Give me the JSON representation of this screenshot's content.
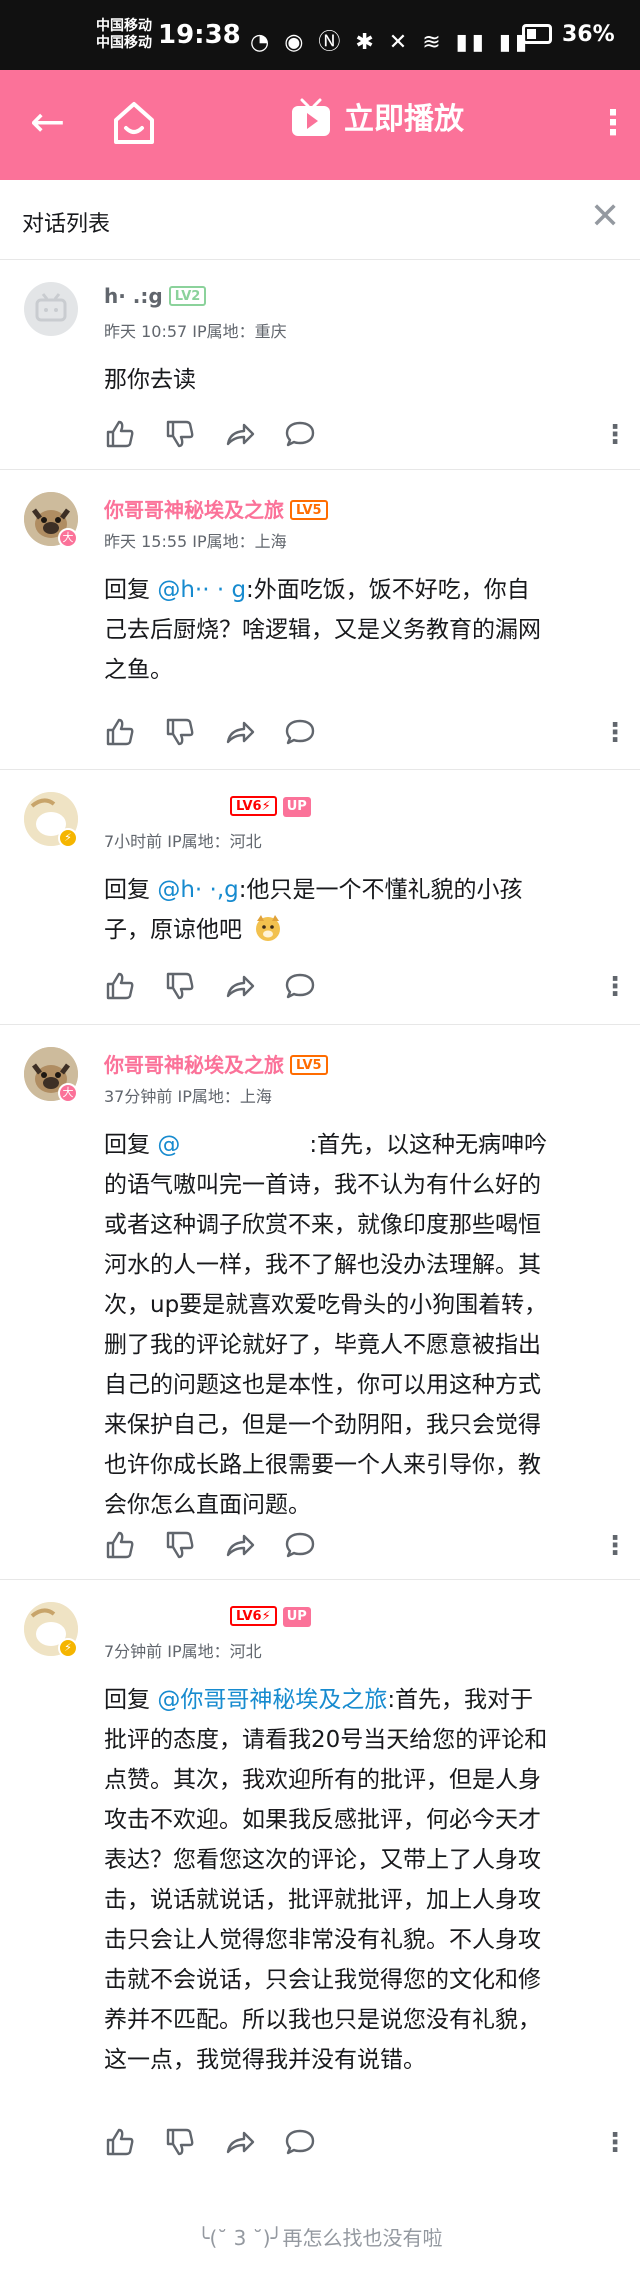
{
  "status_bar": {
    "carrier1": "中国移动",
    "carrier2": "中国移动",
    "time": "19:38",
    "icons": "◔ ◉ Ⓝ ✱ ✕ ≋ ▮▮ ▮▮",
    "battery": "36%"
  },
  "app_bar": {
    "play_label": "立即播放",
    "color": "#fb7299"
  },
  "dialog": {
    "title": "对话列表"
  },
  "comments": [
    {
      "name": "h· .:g",
      "level": "LV2",
      "level_color": "#8bd29b",
      "up_badge": false,
      "time": "昨天 10:57",
      "location": "IP属地：重庆",
      "body_lines": [
        "那你去读"
      ]
    },
    {
      "name": "你哥哥神秘埃及之旅",
      "level": "LV5",
      "level_color": "#ff6c00",
      "name_color": "#fb7299",
      "time": "昨天 15:55",
      "location": "IP属地：上海",
      "reply_prefix": "回复 ",
      "mention": "@h·· · g",
      "body_lines": [
        ":外面吃饭，饭不好吃，你自",
        "己去后厨烧？啥逻辑，又是义务教育的漏网",
        "之鱼。"
      ]
    },
    {
      "name": "",
      "level": "LV6⚡",
      "level_color": "#ff0000",
      "up_badge": "UP",
      "time": "7小时前",
      "location": "IP属地：河北",
      "reply_prefix": "回复 ",
      "mention": "@h· ·,g",
      "body_lines": [
        ":他只是一个不懂礼貌的小孩",
        "子，原谅他吧"
      ]
    },
    {
      "name": "你哥哥神秘埃及之旅",
      "level": "LV5",
      "level_color": "#ff6c00",
      "name_color": "#fb7299",
      "time": "37分钟前",
      "location": "IP属地：上海",
      "reply_prefix": "回复 ",
      "mention": "@",
      "body_lines": [
        ":首先，以这种无病呻吟",
        "的语气嗷叫完一首诗，我不认为有什么好的",
        "或者这种调子欣赏不来，就像印度那些喝恒",
        "河水的人一样，我不了解也没办法理解。其",
        "次，up要是就喜欢爱吃骨头的小狗围着转，",
        "删了我的评论就好了，毕竟人不愿意被指出",
        "自己的问题这也是本性，你可以用这种方式",
        "来保护自己，但是一个劲阴阳，我只会觉得",
        "也许你成长路上很需要一个人来引导你，教",
        "会你怎么直面问题。"
      ]
    },
    {
      "name": "",
      "level": "LV6⚡",
      "level_color": "#ff0000",
      "up_badge": "UP",
      "time": "7分钟前",
      "location": "IP属地：河北",
      "reply_prefix": "回复 ",
      "mention": "@你哥哥神秘埃及之旅",
      "body_lines": [
        ":首先，我对于",
        "批评的态度，请看我20号当天给您的评论和",
        "点赞。其次，我欢迎所有的批评，但是人身",
        "攻击不欢迎。如果我反感批评，何必今天才",
        "表达？您看您这次的评论，又带上了人身攻",
        "击，说话就说话，批评就批评，加上人身攻",
        "击只会让人觉得您非常没有礼貌。不人身攻",
        "击就不会说话，只会让我觉得您的文化和修",
        "养并不匹配。所以我也只是说您没有礼貌，",
        "这一点，我觉得我并没有说错。"
      ]
    }
  ],
  "footer": {
    "text": "╰(˘ 3 ˘)╯再怎么找也没有啦"
  }
}
